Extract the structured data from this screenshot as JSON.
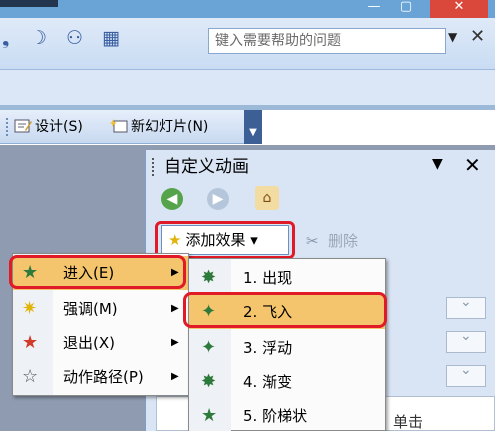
{
  "titlebar": {
    "minimize_glyph": "—",
    "maximize_glyph": "▢",
    "close_glyph": "✕"
  },
  "menurow": {
    "icons": [
      {
        "name": "comma-mark-icon",
        "glyph": "❟"
      },
      {
        "name": "moon-icon",
        "glyph": "☽"
      },
      {
        "name": "user-icon",
        "glyph": "⚇"
      },
      {
        "name": "grid-icon",
        "glyph": "▦"
      }
    ],
    "help_text": "键入需要帮助的问题",
    "help_dropdown_glyph": "▼",
    "help_close_glyph": "✕"
  },
  "toolbar2": {
    "design_label": "设计(S)",
    "new_slide_label": "新幻灯片(N)",
    "more_glyph": "▼"
  },
  "pane": {
    "title": "自定义动画",
    "dropdown_glyph": "▼",
    "close_glyph": "✕",
    "nav_back_glyph": "◀",
    "nav_forward_glyph": "▶",
    "nav_home_glyph": "⌂",
    "add_effect_label": "添加效果",
    "add_effect_arrow": "▾",
    "delete_label": "删除",
    "description_fragment": "单击"
  },
  "menu1": {
    "items": [
      {
        "label": "进入(E)",
        "icon": "enter-star-icon",
        "selected": true
      },
      {
        "label": "强调(M)",
        "icon": "emphasis-star-icon",
        "selected": false
      },
      {
        "label": "退出(X)",
        "icon": "exit-star-icon",
        "selected": false
      },
      {
        "label": "动作路径(P)",
        "icon": "motion-path-icon",
        "selected": false
      }
    ],
    "submenu_arrow": "▶"
  },
  "menu2": {
    "items": [
      {
        "label": "1. 出现",
        "icon": "appear-star-icon",
        "selected": false
      },
      {
        "label": "2. 飞入",
        "icon": "fly-in-star-icon",
        "selected": true
      },
      {
        "label": "3. 浮动",
        "icon": "float-star-icon",
        "selected": false
      },
      {
        "label": "4. 渐变",
        "icon": "fade-star-icon",
        "selected": false
      },
      {
        "label": "5. 阶梯状",
        "icon": "stairs-star-icon",
        "selected": false
      }
    ]
  },
  "colors": {
    "highlight_box": "#e01a26",
    "selected_menu_bg": "#f4c56c",
    "pane_bg": "#d9e5f5"
  }
}
